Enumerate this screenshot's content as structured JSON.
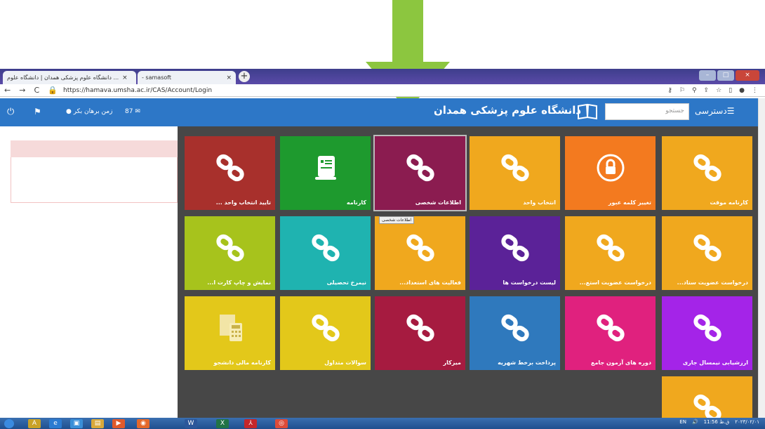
{
  "browser": {
    "tabs": [
      {
        "label": "دانشگاه علوم پزشکی همدان | دانشگاه علوم ..."
      },
      {
        "label": "- samasoft"
      }
    ],
    "url": "https://hamava.umsha.ac.ir/CAS/Account/Login"
  },
  "header": {
    "brand": "دانشگاه علوم پزشکی همدان",
    "search_placeholder": "جستجو",
    "access_label": "دسترسی",
    "user_name": "زمن برهان بکر",
    "mail_count": "87"
  },
  "tiles": [
    {
      "label": "کارنامه موقت",
      "color": "#f0a81e",
      "icon": "link-icon"
    },
    {
      "label": "تغییر کلمه عبور",
      "color": "#f37a1f",
      "icon": "lock-icon"
    },
    {
      "label": "انتخاب واحد",
      "color": "#f0a81e",
      "icon": "link-icon"
    },
    {
      "label": "اطلاعات شخصی",
      "color": "#8b1c50",
      "icon": "link-icon"
    },
    {
      "label": "کارنامه",
      "color": "#1e9a2e",
      "icon": "certificate-icon"
    },
    {
      "label": "تایید انتخاب واحد ...",
      "color": "#a8302c",
      "icon": "link-icon"
    },
    {
      "label": "درخواست عضویت ستاد...",
      "color": "#f0a81e",
      "icon": "link-icon"
    },
    {
      "label": "درخواست عضویت استع...",
      "color": "#f0a81e",
      "icon": "link-icon"
    },
    {
      "label": "لیست درخواست ها",
      "color": "#5b2298",
      "icon": "link-icon"
    },
    {
      "label": "فعالیت های استعداد...",
      "color": "#f0a81e",
      "icon": "link-icon"
    },
    {
      "label": "نیمرخ تحصیلی",
      "color": "#1fb3b0",
      "icon": "link-icon"
    },
    {
      "label": "نمایش و چاپ کارت ا...",
      "color": "#a7c31c",
      "icon": "link-icon"
    },
    {
      "label": "ارزشیابی نیمسال جاری",
      "color": "#a424e8",
      "icon": "link-icon"
    },
    {
      "label": "دوره های آزمون جامع",
      "color": "#e0217e",
      "icon": "link-icon"
    },
    {
      "label": "پرداخت برخط شهریه",
      "color": "#2f79bd",
      "icon": "link-icon"
    },
    {
      "label": "میزکار",
      "color": "#a61b40",
      "icon": "link-icon"
    },
    {
      "label": "سوالات متداول",
      "color": "#e3c81a",
      "icon": "link-icon"
    },
    {
      "label": "کارنامه مالی دانشجو",
      "color": "#e3c81a",
      "icon": "calculator-icon"
    },
    {
      "label": "",
      "color": "#f0a81e",
      "icon": "link-icon"
    }
  ],
  "tooltip": "اطلاعات شخصی",
  "taskbar": {
    "lang": "EN",
    "time": "11:56 ق.ظ",
    "date": "۲۰۲۳/۰۲/۰۱"
  }
}
